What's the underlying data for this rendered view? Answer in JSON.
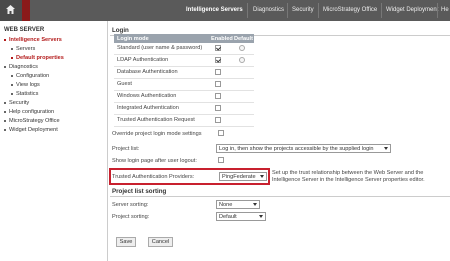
{
  "topnav": {
    "items": [
      "Intelligence Servers",
      "Diagnostics",
      "Security",
      "MicroStrategy Office",
      "Widget Deployment",
      "He"
    ]
  },
  "sidebar": {
    "heading": "WEB SERVER",
    "items": [
      {
        "label": "Intelligence Servers",
        "level": 0,
        "active": true
      },
      {
        "label": "Servers",
        "level": 1
      },
      {
        "label": "Default properties",
        "level": 1,
        "active": true
      },
      {
        "label": "Diagnostics",
        "level": 0
      },
      {
        "label": "Configuration",
        "level": 1
      },
      {
        "label": "View logs",
        "level": 1
      },
      {
        "label": "Statistics",
        "level": 1
      },
      {
        "label": "Security",
        "level": 0
      },
      {
        "label": "Help configuration",
        "level": 0
      },
      {
        "label": "MicroStrategy Office",
        "level": 0
      },
      {
        "label": "Widget Deployment",
        "level": 0
      }
    ]
  },
  "login": {
    "section_title": "Login",
    "columns": [
      "Login mode",
      "Enabled",
      "Default"
    ],
    "modes": [
      {
        "label": "Standard (user name & password)",
        "enabled": true,
        "default": false
      },
      {
        "label": "LDAP Authentication",
        "enabled": true,
        "default": false
      },
      {
        "label": "Database Authentication",
        "enabled": false,
        "default": false
      },
      {
        "label": "Guest",
        "enabled": false,
        "default": false
      },
      {
        "label": "Windows Authentication",
        "enabled": false,
        "default": false
      },
      {
        "label": "Integrated Authentication",
        "enabled": false,
        "default": false
      },
      {
        "label": "Trusted Authentication Request",
        "enabled": false,
        "default": false
      }
    ],
    "override_label": "Override project login mode settings",
    "project_list_label": "Project list:",
    "project_list_value": "Log in, then show the projects accessible by the supplied login",
    "show_login_label": "Show login page after user logout:",
    "trusted_label": "Trusted Authentication Providers:",
    "trusted_value": "PingFederate",
    "trusted_note": "Set up the trust relationship between the Web Server and the Intelligence Server in the Intelligence Server properties editor."
  },
  "sorting": {
    "section_title": "Project list sorting",
    "server_label": "Server sorting:",
    "server_value": "None",
    "project_label": "Project sorting:",
    "project_value": "Default"
  },
  "buttons": {
    "save": "Save",
    "cancel": "Cancel"
  },
  "colors": {
    "accent_red": "#c8202e",
    "topbar": "#5a5a5a",
    "active_link": "#b31a1a"
  }
}
